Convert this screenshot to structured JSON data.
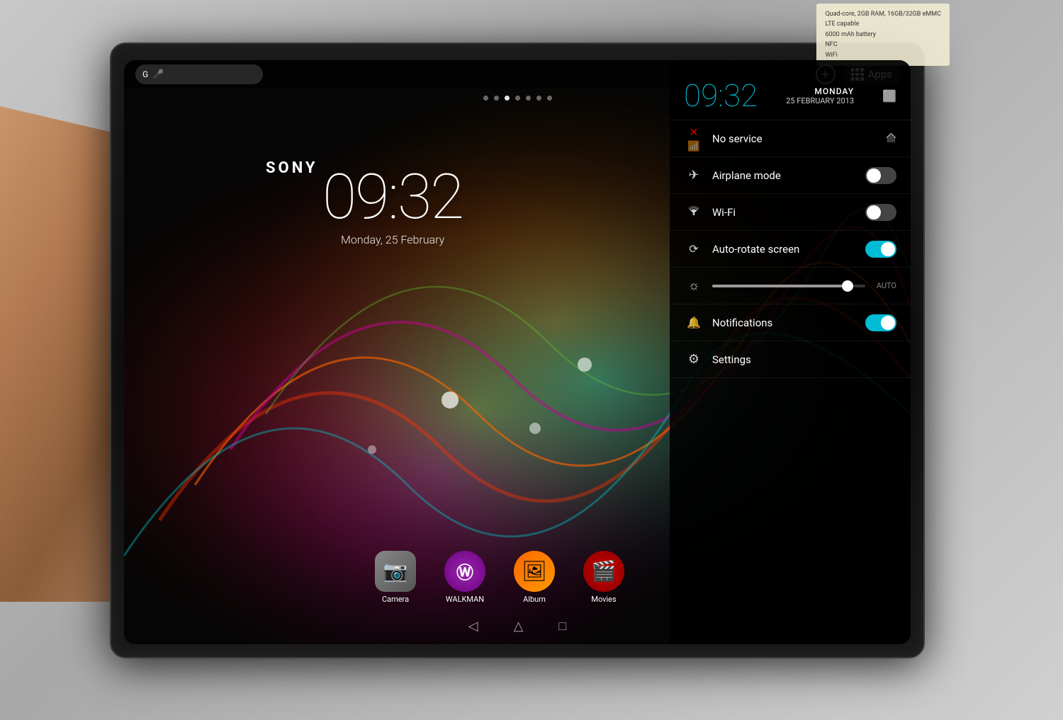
{
  "scene": {
    "brand": "SONY"
  },
  "tablet": {
    "screen": {
      "clock": {
        "time": "09:32",
        "date": "Monday, 25 February"
      },
      "page_dots": [
        false,
        false,
        true,
        false,
        false,
        false,
        false
      ],
      "top_bar": {
        "add_button": "+",
        "apps_label": "Apps"
      },
      "dock": {
        "apps": [
          {
            "label": "Camera",
            "icon": "📷",
            "bg": "camera"
          },
          {
            "label": "WALKMAN",
            "icon": "Ⓦ",
            "bg": "walkman"
          },
          {
            "label": "Album",
            "icon": "🖼",
            "bg": "album"
          },
          {
            "label": "Movies",
            "icon": "🎬",
            "bg": "movies"
          }
        ]
      },
      "nav": {
        "back": "◁",
        "home": "△",
        "recents": "□"
      }
    },
    "quick_settings": {
      "panel_time": "09:32",
      "panel_day": "MONDAY",
      "panel_date": "25 FEBRUARY 2013",
      "signal": {
        "label": "No service",
        "icon": "📶"
      },
      "rows": [
        {
          "id": "airplane",
          "icon": "✈",
          "label": "Airplane mode",
          "has_toggle": true,
          "toggle_on": false
        },
        {
          "id": "wifi",
          "icon": "📶",
          "label": "Wi-Fi",
          "has_toggle": true,
          "toggle_on": false
        },
        {
          "id": "autorotate",
          "icon": "⟳",
          "label": "Auto-rotate screen",
          "has_toggle": true,
          "toggle_on": true
        },
        {
          "id": "brightness",
          "icon": "☼",
          "label": "AUTO",
          "is_brightness": true
        },
        {
          "id": "notifications",
          "icon": "🔔",
          "label": "Notifications",
          "has_toggle": true,
          "toggle_on": true
        },
        {
          "id": "settings",
          "icon": "⚙",
          "label": "Settings",
          "has_toggle": false
        }
      ]
    }
  },
  "info_card": {
    "lines": [
      "Quad-core, 2GB RAM, 16GB/32GB eMMC",
      "LTE capable",
      "6000 mAh battery",
      "NFC",
      "WiFi"
    ]
  }
}
